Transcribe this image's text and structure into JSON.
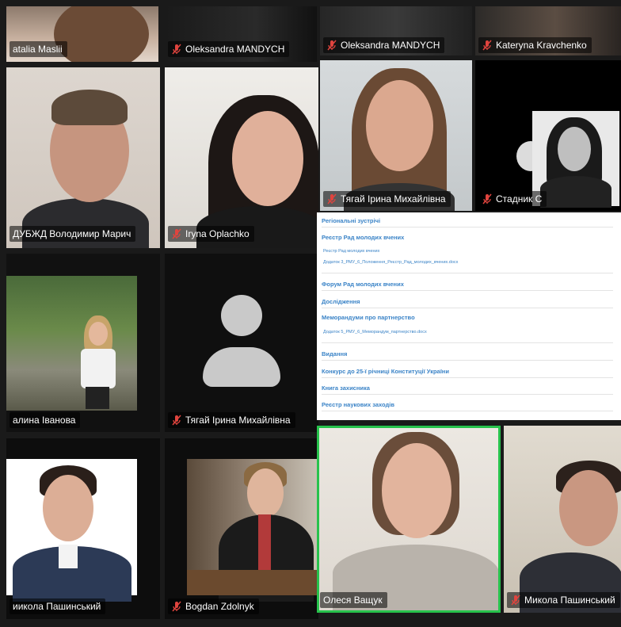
{
  "participants": [
    {
      "id": "natalia",
      "name": "atalia Maslii",
      "muted": false
    },
    {
      "id": "oleksandra1",
      "name": "Oleksandra MANDYCH",
      "muted": true
    },
    {
      "id": "oleksandra2",
      "name": "Oleksandra MANDYCH",
      "muted": true
    },
    {
      "id": "kateryna",
      "name": "Kateryna Kravchenko",
      "muted": true
    },
    {
      "id": "volodymyr",
      "name": "ДУБЖД Володимир Марич",
      "muted": false
    },
    {
      "id": "iryna",
      "name": "Iryna Oplachko",
      "muted": true
    },
    {
      "id": "tyahai_video",
      "name": "Тягай Ірина Михайлівна",
      "muted": true
    },
    {
      "id": "stadnyk",
      "name": "Стадник С",
      "muted": true
    },
    {
      "id": "halyna",
      "name": "алина Іванова",
      "muted": false
    },
    {
      "id": "tyahai_avatar",
      "name": "Тягай Ірина Михайлівна",
      "muted": true
    },
    {
      "id": "mykola1",
      "name": "иикола Пашинський",
      "muted": false
    },
    {
      "id": "bogdan",
      "name": "Bogdan Zdolnyk",
      "muted": true
    },
    {
      "id": "olesia",
      "name": "Олеся Ващук",
      "muted": false,
      "active": true
    },
    {
      "id": "mykola2",
      "name": "Микола Пашинський",
      "muted": true
    }
  ],
  "shared_doc": {
    "items": [
      {
        "title": "Регіональні зустрічі"
      },
      {
        "title": "Реєстр Рад молодих вчених",
        "subs": [
          "Реєстр Рад молодих вчених",
          "Додаток 3_РМУ_6_Положення_Реєстр_Рад_молодих_вчених.docx"
        ]
      },
      {
        "title": "Форум Рад молодих вчених"
      },
      {
        "title": "Дослідження"
      },
      {
        "title": "Меморандуми про партнерство",
        "subs": [
          "Додаток 5_РМУ_6_Меморандум_партнерство.docx"
        ]
      },
      {
        "title": "Видання"
      },
      {
        "title": "Конкурс до 25-ї річниці Конституції України"
      },
      {
        "title": "Книга захисника"
      },
      {
        "title": "Реєстр наукових заходів"
      }
    ]
  },
  "colors": {
    "active_speaker": "#27c24c",
    "muted_icon": "#e0443e",
    "link": "#3a83c7"
  }
}
